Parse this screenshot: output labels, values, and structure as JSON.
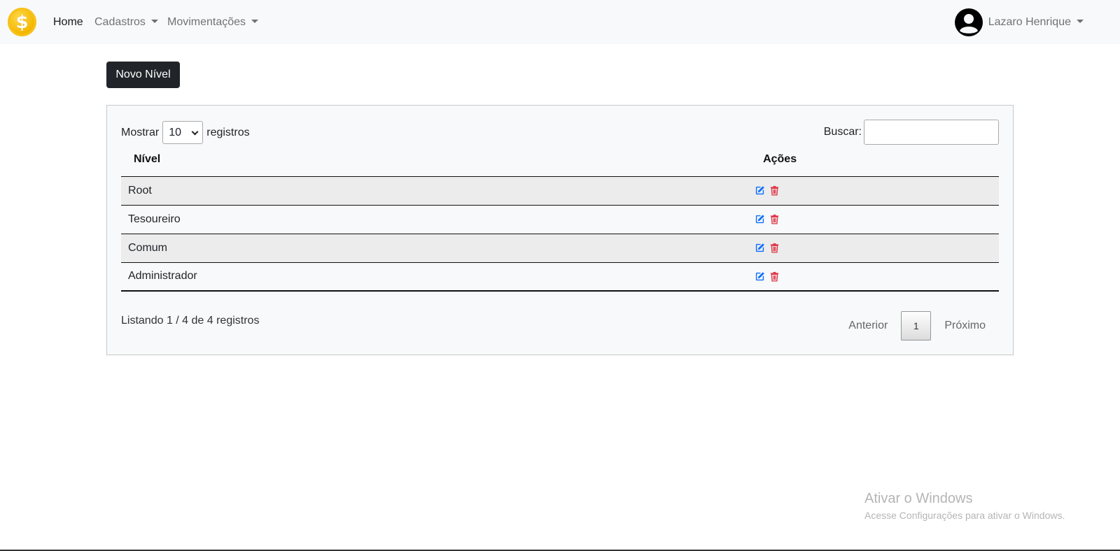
{
  "navbar": {
    "logo_symbol": "$",
    "items": [
      {
        "label": "Home",
        "active": true,
        "dropdown": false
      },
      {
        "label": "Cadastros",
        "active": false,
        "dropdown": true
      },
      {
        "label": "Movimentações",
        "active": false,
        "dropdown": true
      }
    ],
    "user": {
      "name": "Lazaro Henrique",
      "icon": "user-circle-icon"
    }
  },
  "toolbar": {
    "new_button_label": "Novo Nível"
  },
  "table_controls": {
    "show_label": "Mostrar",
    "page_size": "10",
    "records_label": "registros",
    "search_label": "Buscar:",
    "search_value": ""
  },
  "table": {
    "columns": [
      "Nível",
      "Ações"
    ],
    "rows": [
      {
        "nivel": "Root"
      },
      {
        "nivel": "Tesoureiro"
      },
      {
        "nivel": "Comum"
      },
      {
        "nivel": "Administrador"
      }
    ],
    "action_icons": [
      "edit-icon",
      "trash-icon"
    ]
  },
  "footer": {
    "info": "Listando 1 / 4 de 4 registros",
    "prev_label": "Anterior",
    "current_page": "1",
    "next_label": "Próximo"
  },
  "watermark": {
    "title": "Ativar o Windows",
    "subtitle": "Acesse Configurações para ativar o Windows."
  },
  "colors": {
    "navbar_bg": "#f8f9fa",
    "button_dark": "#212529",
    "edit_icon": "#0d6efd",
    "delete_icon": "#dc3545",
    "logo": "#f5b800"
  }
}
